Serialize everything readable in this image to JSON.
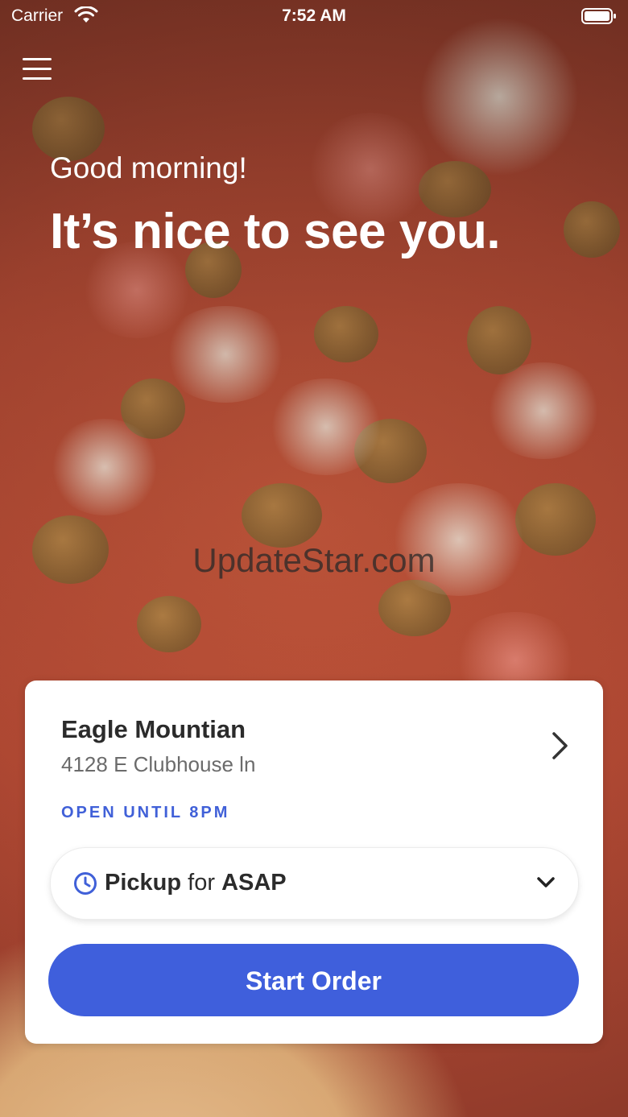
{
  "status_bar": {
    "carrier": "Carrier",
    "time": "7:52 AM",
    "icons": [
      "wifi-icon",
      "battery-icon"
    ]
  },
  "header": {
    "menu_icon": "hamburger-menu-icon",
    "greeting": "Good morning!",
    "headline": "It’s nice to see you."
  },
  "watermark": "UpdateStar.com",
  "store": {
    "name": "Eagle Mountian",
    "address": "4128 E Clubhouse ln",
    "hours": "OPEN UNTIL 8PM",
    "chevron_icon": "chevron-right-icon"
  },
  "order_mode": {
    "icon": "clock-icon",
    "mode": "Pickup",
    "connector": "for",
    "time": "ASAP",
    "dropdown_icon": "chevron-down-icon"
  },
  "start_order_label": "Start Order",
  "colors": {
    "accent": "#3f5fdc",
    "hours_text": "#4060d8",
    "title_text": "#2b2b2b",
    "secondary_text": "#6b6b6b"
  }
}
